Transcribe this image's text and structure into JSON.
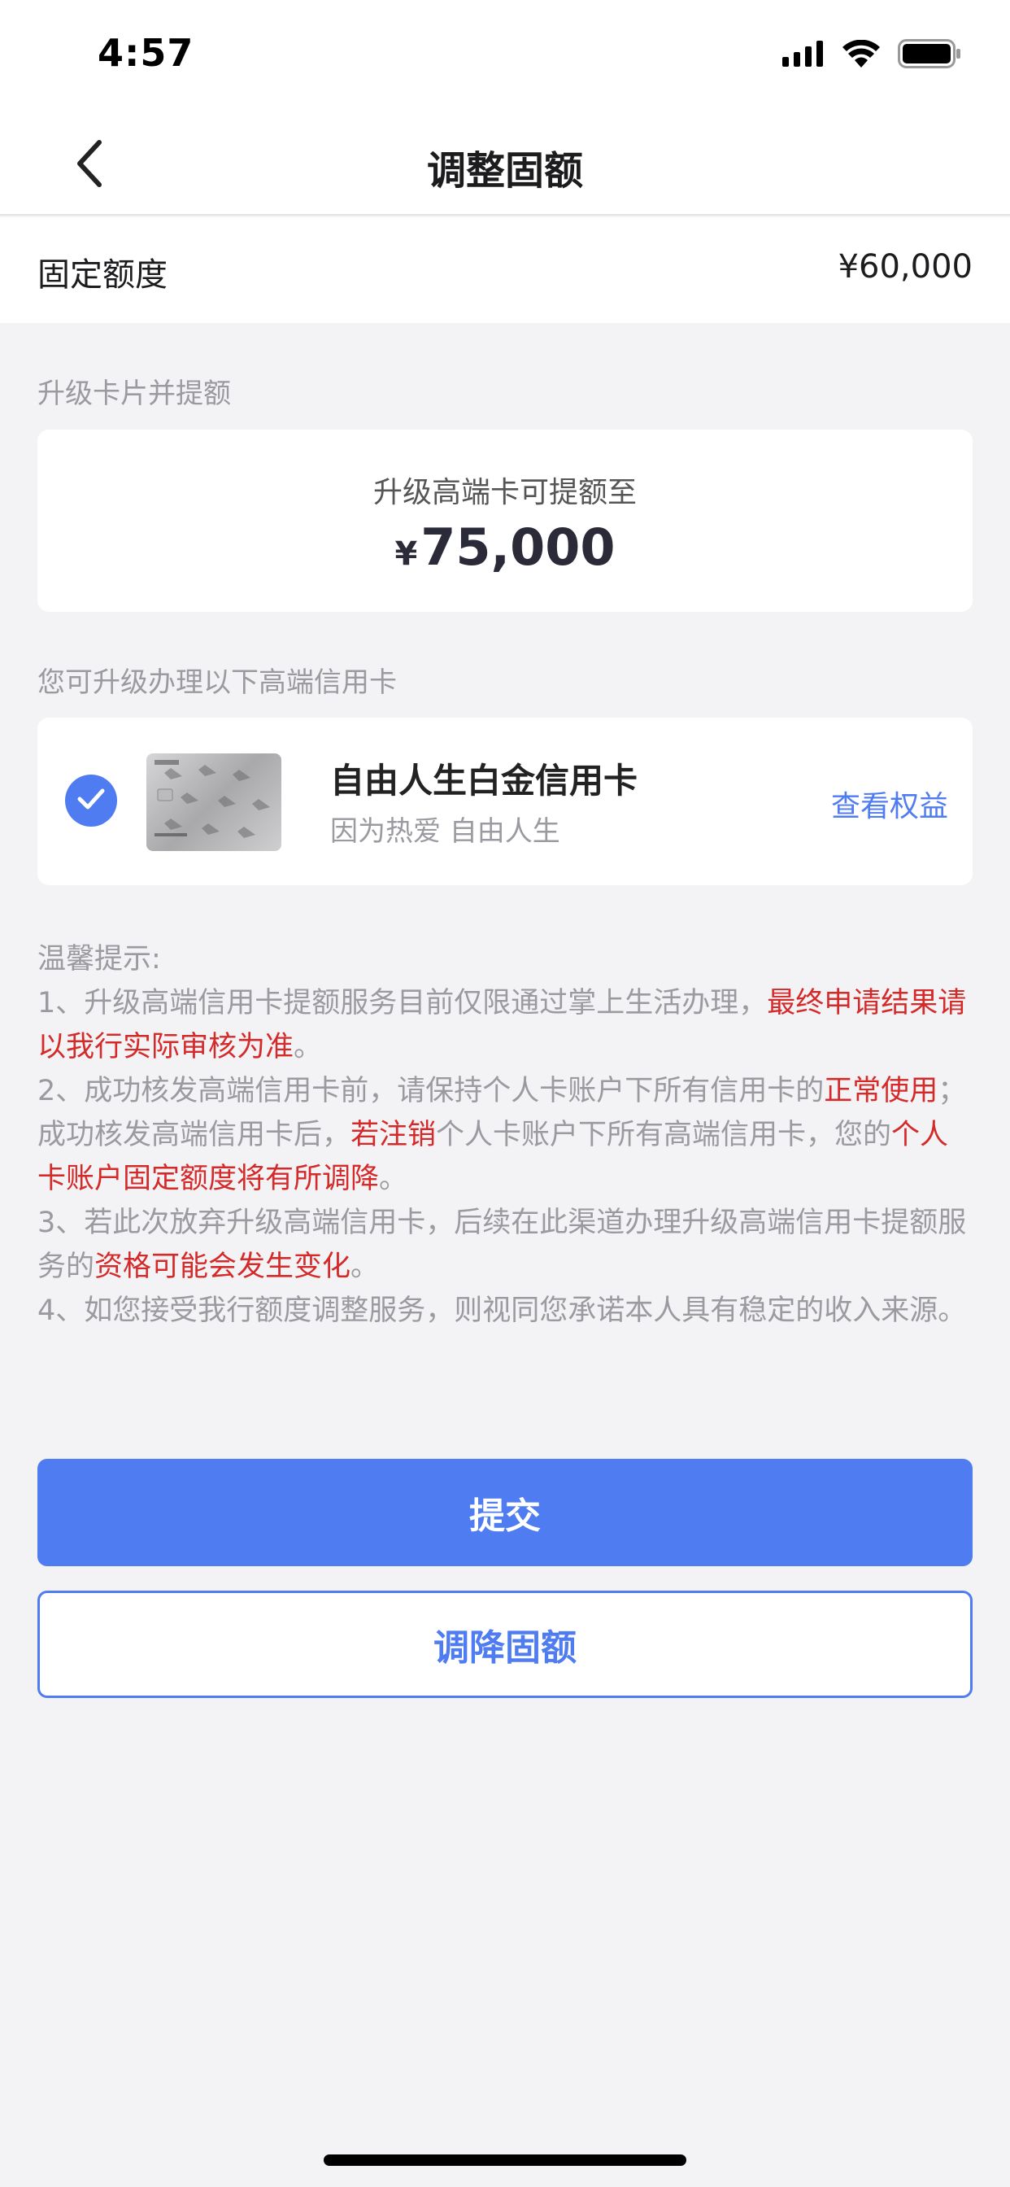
{
  "status_bar": {
    "time": "4:57"
  },
  "nav": {
    "title": "调整固额",
    "back_icon": "chevron-left-icon"
  },
  "fixed_limit": {
    "label": "固定额度",
    "value": "¥60,000"
  },
  "upgrade_section": {
    "label": "升级卡片并提额",
    "subtitle": "升级高端卡可提额至",
    "currency": "¥",
    "amount": "75,000"
  },
  "card_section": {
    "label": "您可升级办理以下高端信用卡",
    "card": {
      "name": "自由人生白金信用卡",
      "slogan": "因为热爱 自由人生",
      "link": "查看权益",
      "selected": true
    }
  },
  "tips": {
    "title": "温馨提示:",
    "items": [
      [
        {
          "text": "1、升级高端信用卡提额服务目前仅限通过掌上生活办理，",
          "red": false
        },
        {
          "text": "最终申请结果请以我行实际审核为准",
          "red": true
        },
        {
          "text": "。",
          "red": false
        }
      ],
      [
        {
          "text": "2、成功核发高端信用卡前，请保持个人卡账户下所有信用卡的",
          "red": false
        },
        {
          "text": "正常使用",
          "red": true
        },
        {
          "text": "；成功核发高端信用卡后，",
          "red": false
        },
        {
          "text": "若注销",
          "red": true
        },
        {
          "text": "个人卡账户下所有高端信用卡，您的",
          "red": false
        },
        {
          "text": "个人卡账户固定额度将有所调降",
          "red": true
        },
        {
          "text": "。",
          "red": false
        }
      ],
      [
        {
          "text": "3、若此次放弃升级高端信用卡，后续在此渠道办理升级高端信用卡提额服务的",
          "red": false
        },
        {
          "text": "资格可能会发生变化",
          "red": true
        },
        {
          "text": "。",
          "red": false
        }
      ],
      [
        {
          "text": "4、如您接受我行额度调整服务，则视同您承诺本人具有稳定的收入来源。",
          "red": false
        }
      ]
    ]
  },
  "buttons": {
    "submit": "提交",
    "decrease": "调降固额"
  },
  "colors": {
    "accent": "#4f7cf0",
    "warning_red": "#d42a2a",
    "background": "#f3f3f5"
  }
}
